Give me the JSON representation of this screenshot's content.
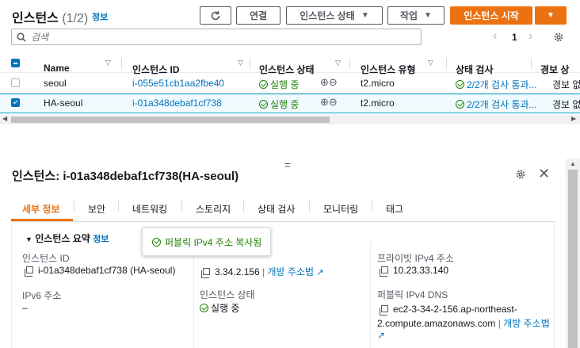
{
  "header": {
    "title": "인스턴스",
    "count": "(1/2)",
    "info": "정보",
    "connect_label": "연결",
    "state_label": "인스턴스 상태",
    "actions_label": "작업",
    "launch_label": "인스턴스 시작"
  },
  "search": {
    "placeholder": "검색"
  },
  "pagination": {
    "page": "1"
  },
  "table": {
    "columns": [
      "Name",
      "인스턴스 ID",
      "인스턴스 상태",
      "인스턴스 유형",
      "상태 검사",
      "경보 상"
    ],
    "rows": [
      {
        "name": "seoul",
        "id": "i-055e51cb1aa2fbe40",
        "state": "실행 중",
        "type": "t2.micro",
        "check": "2/2개 검사 통과...",
        "alarm": "경보 없",
        "selected": false
      },
      {
        "name": "HA-seoul",
        "id": "i-01a348debaf1cf738",
        "state": "실행 중",
        "type": "t2.micro",
        "check": "2/2개 검사 통과...",
        "alarm": "경보 없",
        "selected": true
      }
    ]
  },
  "detail": {
    "title": "인스턴스: i-01a348debaf1cf738(HA-seoul)",
    "tabs": [
      "세부 정보",
      "보안",
      "네트워킹",
      "스토리지",
      "상태 검사",
      "모니터링",
      "태그"
    ],
    "summary_label": "인스턴스 요약",
    "summary_info": "정보",
    "toast": "퍼블릭 IPv4 주소 복사됨",
    "instance_id_label": "인스턴스 ID",
    "instance_id_value": "i-01a348debaf1cf738 (HA-seoul)",
    "public_ip_value": "3.34.2.156",
    "open_address_label": "개방 주소법",
    "private_ip_label": "프라이빗 IPv4 주소",
    "private_ip_value": "10.23.33.140",
    "ipv6_label": "IPv6 주소",
    "ipv6_value": "–",
    "state_label": "인스턴스 상태",
    "state_value": "실행 중",
    "public_dns_label": "퍼블릭 IPv4 DNS",
    "public_dns_line1": "ec2-3-34-2-156.ap-northeast-",
    "public_dns_line2": "2.compute.amazonaws.com",
    "public_dns_link": "개방 주소법"
  },
  "colors": {
    "accent": "#ec7211",
    "link": "#0073bb",
    "ok": "#1d8102"
  }
}
